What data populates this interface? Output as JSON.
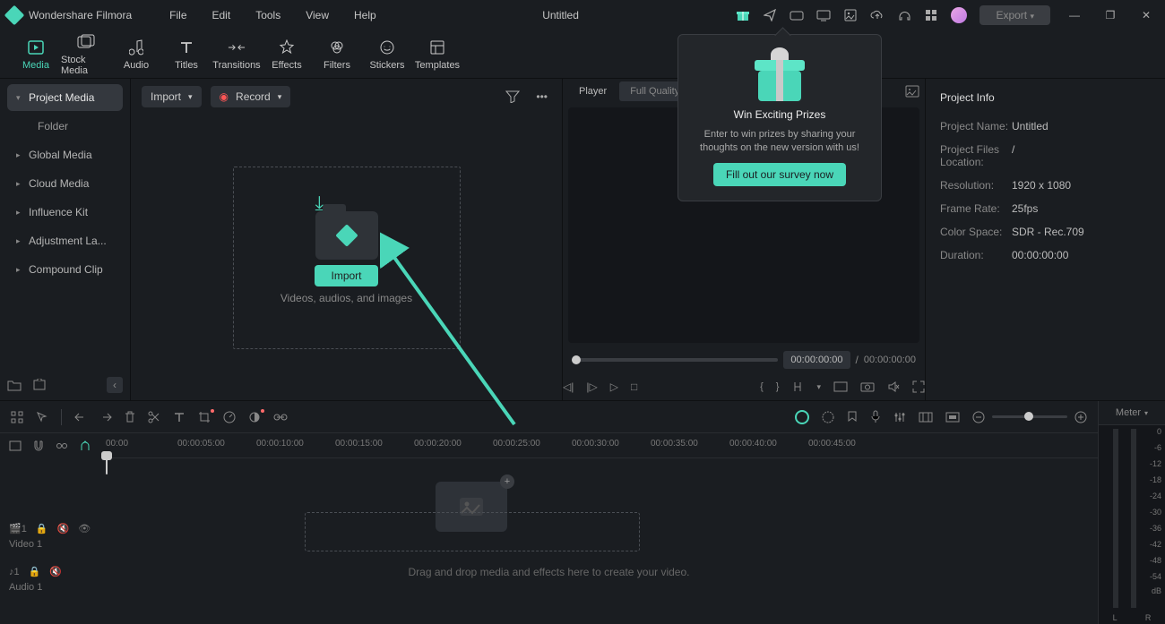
{
  "app": {
    "name": "Wondershare Filmora",
    "title": "Untitled"
  },
  "menu": {
    "file": "File",
    "edit": "Edit",
    "tools": "Tools",
    "view": "View",
    "help": "Help"
  },
  "titlebar": {
    "export": "Export"
  },
  "tabs": {
    "media": "Media",
    "stock": "Stock Media",
    "audio": "Audio",
    "titles": "Titles",
    "transitions": "Transitions",
    "effects": "Effects",
    "filters": "Filters",
    "stickers": "Stickers",
    "templates": "Templates"
  },
  "sidebar": {
    "project_media": "Project Media",
    "folder": "Folder",
    "global": "Global Media",
    "cloud": "Cloud Media",
    "influence": "Influence Kit",
    "adjustment": "Adjustment La...",
    "compound": "Compound Clip"
  },
  "media_tools": {
    "import": "Import",
    "record": "Record"
  },
  "drop": {
    "import": "Import",
    "hint": "Videos, audios, and images"
  },
  "preview": {
    "tab_player": "Player",
    "tab_quality": "Full Quality",
    "cur": "00:00:00:00",
    "sep": "/",
    "dur": "00:00:00:00",
    "bracket_l": "{",
    "bracket_r": "}"
  },
  "info": {
    "title": "Project Info",
    "name_label": "Project Name:",
    "name_val": "Untitled",
    "loc_label": "Project Files Location:",
    "loc_val": "/",
    "res_label": "Resolution:",
    "res_val": "1920 x 1080",
    "fps_label": "Frame Rate:",
    "fps_val": "25fps",
    "cs_label": "Color Space:",
    "cs_val": "SDR - Rec.709",
    "dur_label": "Duration:",
    "dur_val": "00:00:00:00"
  },
  "timeline": {
    "hint": "Drag and drop media and effects here to create your video.",
    "video1": "Video 1",
    "audio1": "Audio 1",
    "marks": [
      "00:00",
      "00:00:05:00",
      "00:00:10:00",
      "00:00:15:00",
      "00:00:20:00",
      "00:00:25:00",
      "00:00:30:00",
      "00:00:35:00",
      "00:00:40:00",
      "00:00:45:00"
    ],
    "meter_label": "Meter",
    "meter_ticks": [
      "0",
      "-6",
      "-12",
      "-18",
      "-24",
      "-30",
      "-36",
      "-42",
      "-48",
      "-54",
      "dB"
    ],
    "meter_l": "L",
    "meter_r": "R"
  },
  "popup": {
    "title": "Win Exciting Prizes",
    "text": "Enter to win prizes by sharing your thoughts on the new version with us!",
    "cta": "Fill out our survey now"
  }
}
